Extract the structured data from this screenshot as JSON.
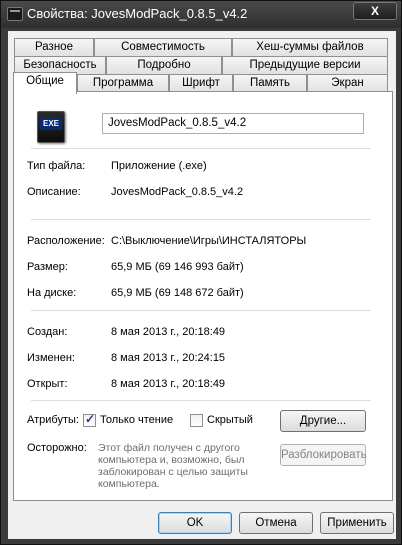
{
  "window": {
    "title": "Свойства: JovesModPack_0.8.5_v4.2",
    "close_glyph": "X"
  },
  "tabs": {
    "row1": [
      "Разное",
      "Совместимость",
      "Хеш-суммы файлов"
    ],
    "row2": [
      "Безопасность",
      "Подробно",
      "Предыдущие версии"
    ],
    "row3": [
      "Общие",
      "Программа",
      "Шрифт",
      "Память",
      "Экран"
    ],
    "active": "Общие"
  },
  "general": {
    "icon_label": "EXE",
    "file_name": "JovesModPack_0.8.5_v4.2",
    "file_type_label": "Тип файла:",
    "file_type_value": "Приложение (.exe)",
    "description_label": "Описание:",
    "description_value": "JovesModPack_0.8.5_v4.2",
    "location_label": "Расположение:",
    "location_value": "C:\\Выключение\\Игры\\ИНСТАЛЯТОРЫ",
    "size_label": "Размер:",
    "size_value": "65,9 МБ (69 146 993 байт)",
    "ondisk_label": "На диске:",
    "ondisk_value": "65,9 МБ (69 148 672 байт)",
    "created_label": "Создан:",
    "created_value": "8 мая 2013 г., 20:18:49",
    "modified_label": "Изменен:",
    "modified_value": "8 мая 2013 г., 20:24:15",
    "accessed_label": "Открыт:",
    "accessed_value": "8 мая 2013 г., 20:18:49",
    "attributes_label": "Атрибуты:",
    "readonly_label": "Только чтение",
    "readonly_checked": true,
    "hidden_label": "Скрытый",
    "hidden_checked": false,
    "other_button": "Другие...",
    "caution_label": "Осторожно:",
    "caution_text": "Этот файл получен с другого компьютера и, возможно, был заблокирован с целью защиты компьютера.",
    "unblock_button": "Разблокировать"
  },
  "footer": {
    "ok": "OK",
    "cancel": "Отмена",
    "apply": "Применить"
  }
}
